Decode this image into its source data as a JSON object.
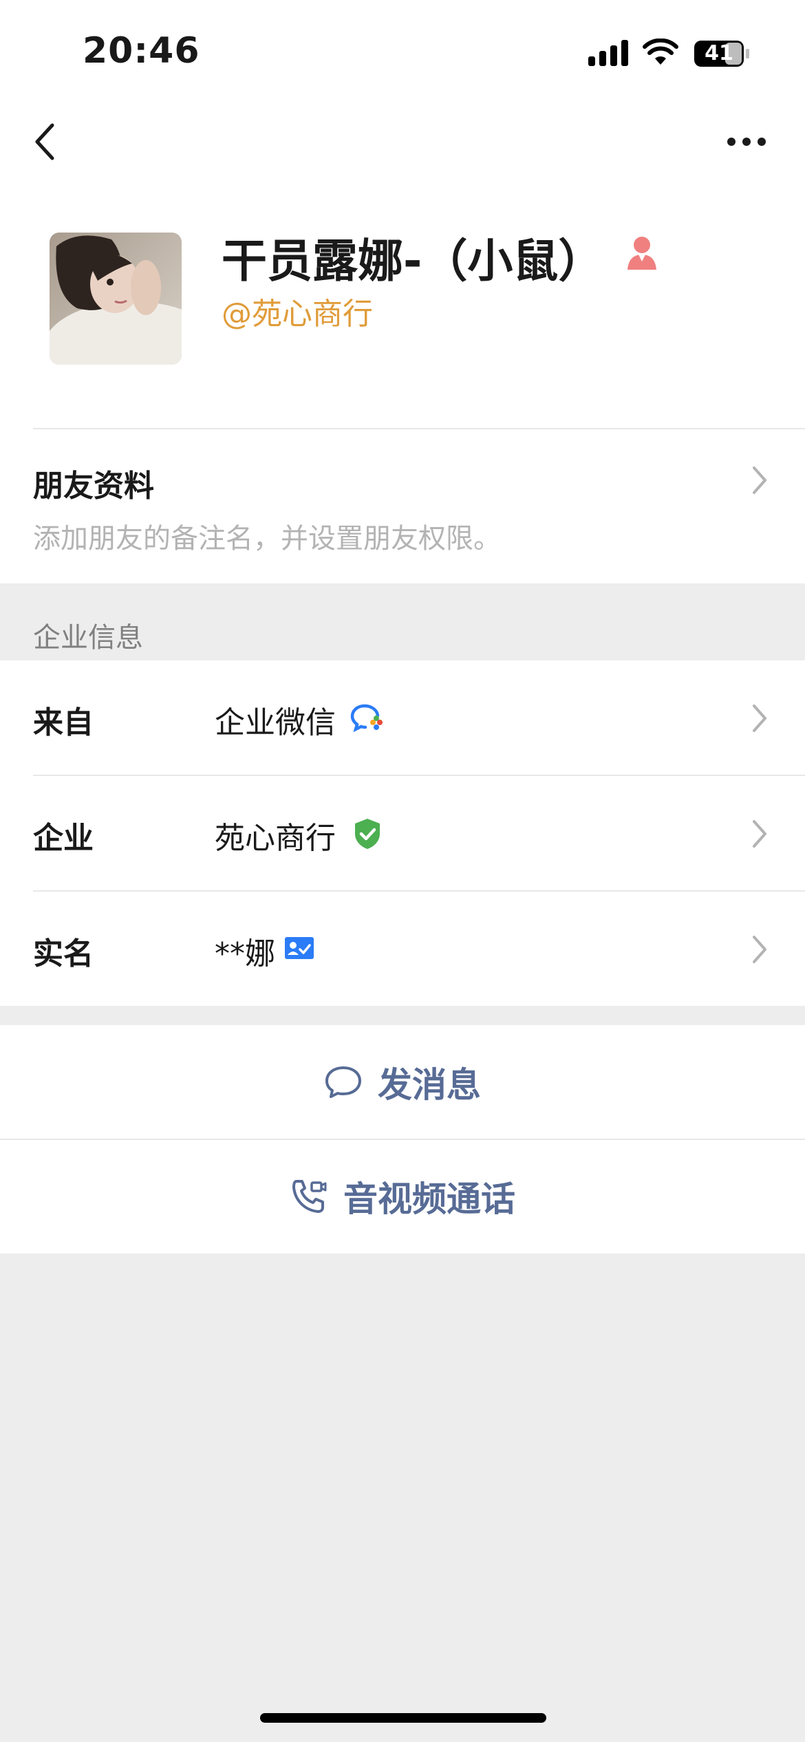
{
  "status_bar": {
    "time": "20:46",
    "battery": "41"
  },
  "profile": {
    "name": "干员露娜-（小鼠）",
    "corp_tag": "@苑心商行"
  },
  "friend_info": {
    "title": "朋友资料",
    "description": "添加朋友的备注名，并设置朋友权限。"
  },
  "enterprise_section": {
    "label": "企业信息",
    "rows": [
      {
        "label": "来自",
        "value": "企业微信"
      },
      {
        "label": "企业",
        "value": "苑心商行"
      },
      {
        "label": "实名",
        "value": "**娜"
      }
    ]
  },
  "actions": {
    "message": "发消息",
    "call": "音视频通话"
  },
  "colors": {
    "link": "#576b95",
    "corp_tag": "#e09c3a",
    "verified": "#4caf50",
    "realname_badge": "#2b7cf6",
    "female": "#f08080"
  }
}
